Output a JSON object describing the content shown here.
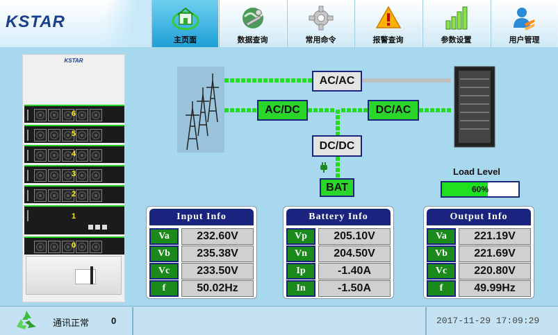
{
  "app": {
    "logo": "KSTAR",
    "cabinet_brand": "KSTAR"
  },
  "nav": [
    {
      "label": "主页面",
      "icon": "home-icon",
      "active": true
    },
    {
      "label": "数据查询",
      "icon": "data-query-icon",
      "active": false
    },
    {
      "label": "常用命令",
      "icon": "gear-icon",
      "active": false
    },
    {
      "label": "报警查询",
      "icon": "warning-icon",
      "active": false
    },
    {
      "label": "参数设置",
      "icon": "chart-bars-icon",
      "active": false
    },
    {
      "label": "用户管理",
      "icon": "users-icon",
      "active": false
    }
  ],
  "cabinet": {
    "modules": [
      "6",
      "5",
      "4",
      "3",
      "2",
      "1",
      "0"
    ]
  },
  "diagram": {
    "ac_ac": "AC/AC",
    "ac_dc": "AC/DC",
    "dc_ac": "DC/AC",
    "dc_dc": "DC/DC",
    "bat": "BAT"
  },
  "load": {
    "label": "Load Level",
    "value_text": "60%",
    "value": 60
  },
  "input_info": {
    "title": "Input Info",
    "rows": [
      {
        "label": "Va",
        "value": "232.60V"
      },
      {
        "label": "Vb",
        "value": "235.38V"
      },
      {
        "label": "Vc",
        "value": "233.50V"
      },
      {
        "label": "f",
        "value": "50.02Hz"
      }
    ]
  },
  "battery_info": {
    "title": "Battery Info",
    "rows": [
      {
        "label": "Vp",
        "value": "205.10V"
      },
      {
        "label": "Vn",
        "value": "204.50V"
      },
      {
        "label": "Ip",
        "value": "-1.40A"
      },
      {
        "label": "In",
        "value": "-1.50A"
      }
    ]
  },
  "output_info": {
    "title": "Output Info",
    "rows": [
      {
        "label": "Va",
        "value": "221.19V"
      },
      {
        "label": "Vb",
        "value": "221.69V"
      },
      {
        "label": "Vc",
        "value": "220.80V"
      },
      {
        "label": "f",
        "value": "49.99Hz"
      }
    ]
  },
  "status": {
    "comm_label": "通讯正常",
    "comm_count": "0",
    "datetime": "2017-11-29 17:09:29"
  },
  "colors": {
    "accent": "#1a237e",
    "ok_green": "#22dd22",
    "background": "#a8d8ee"
  }
}
